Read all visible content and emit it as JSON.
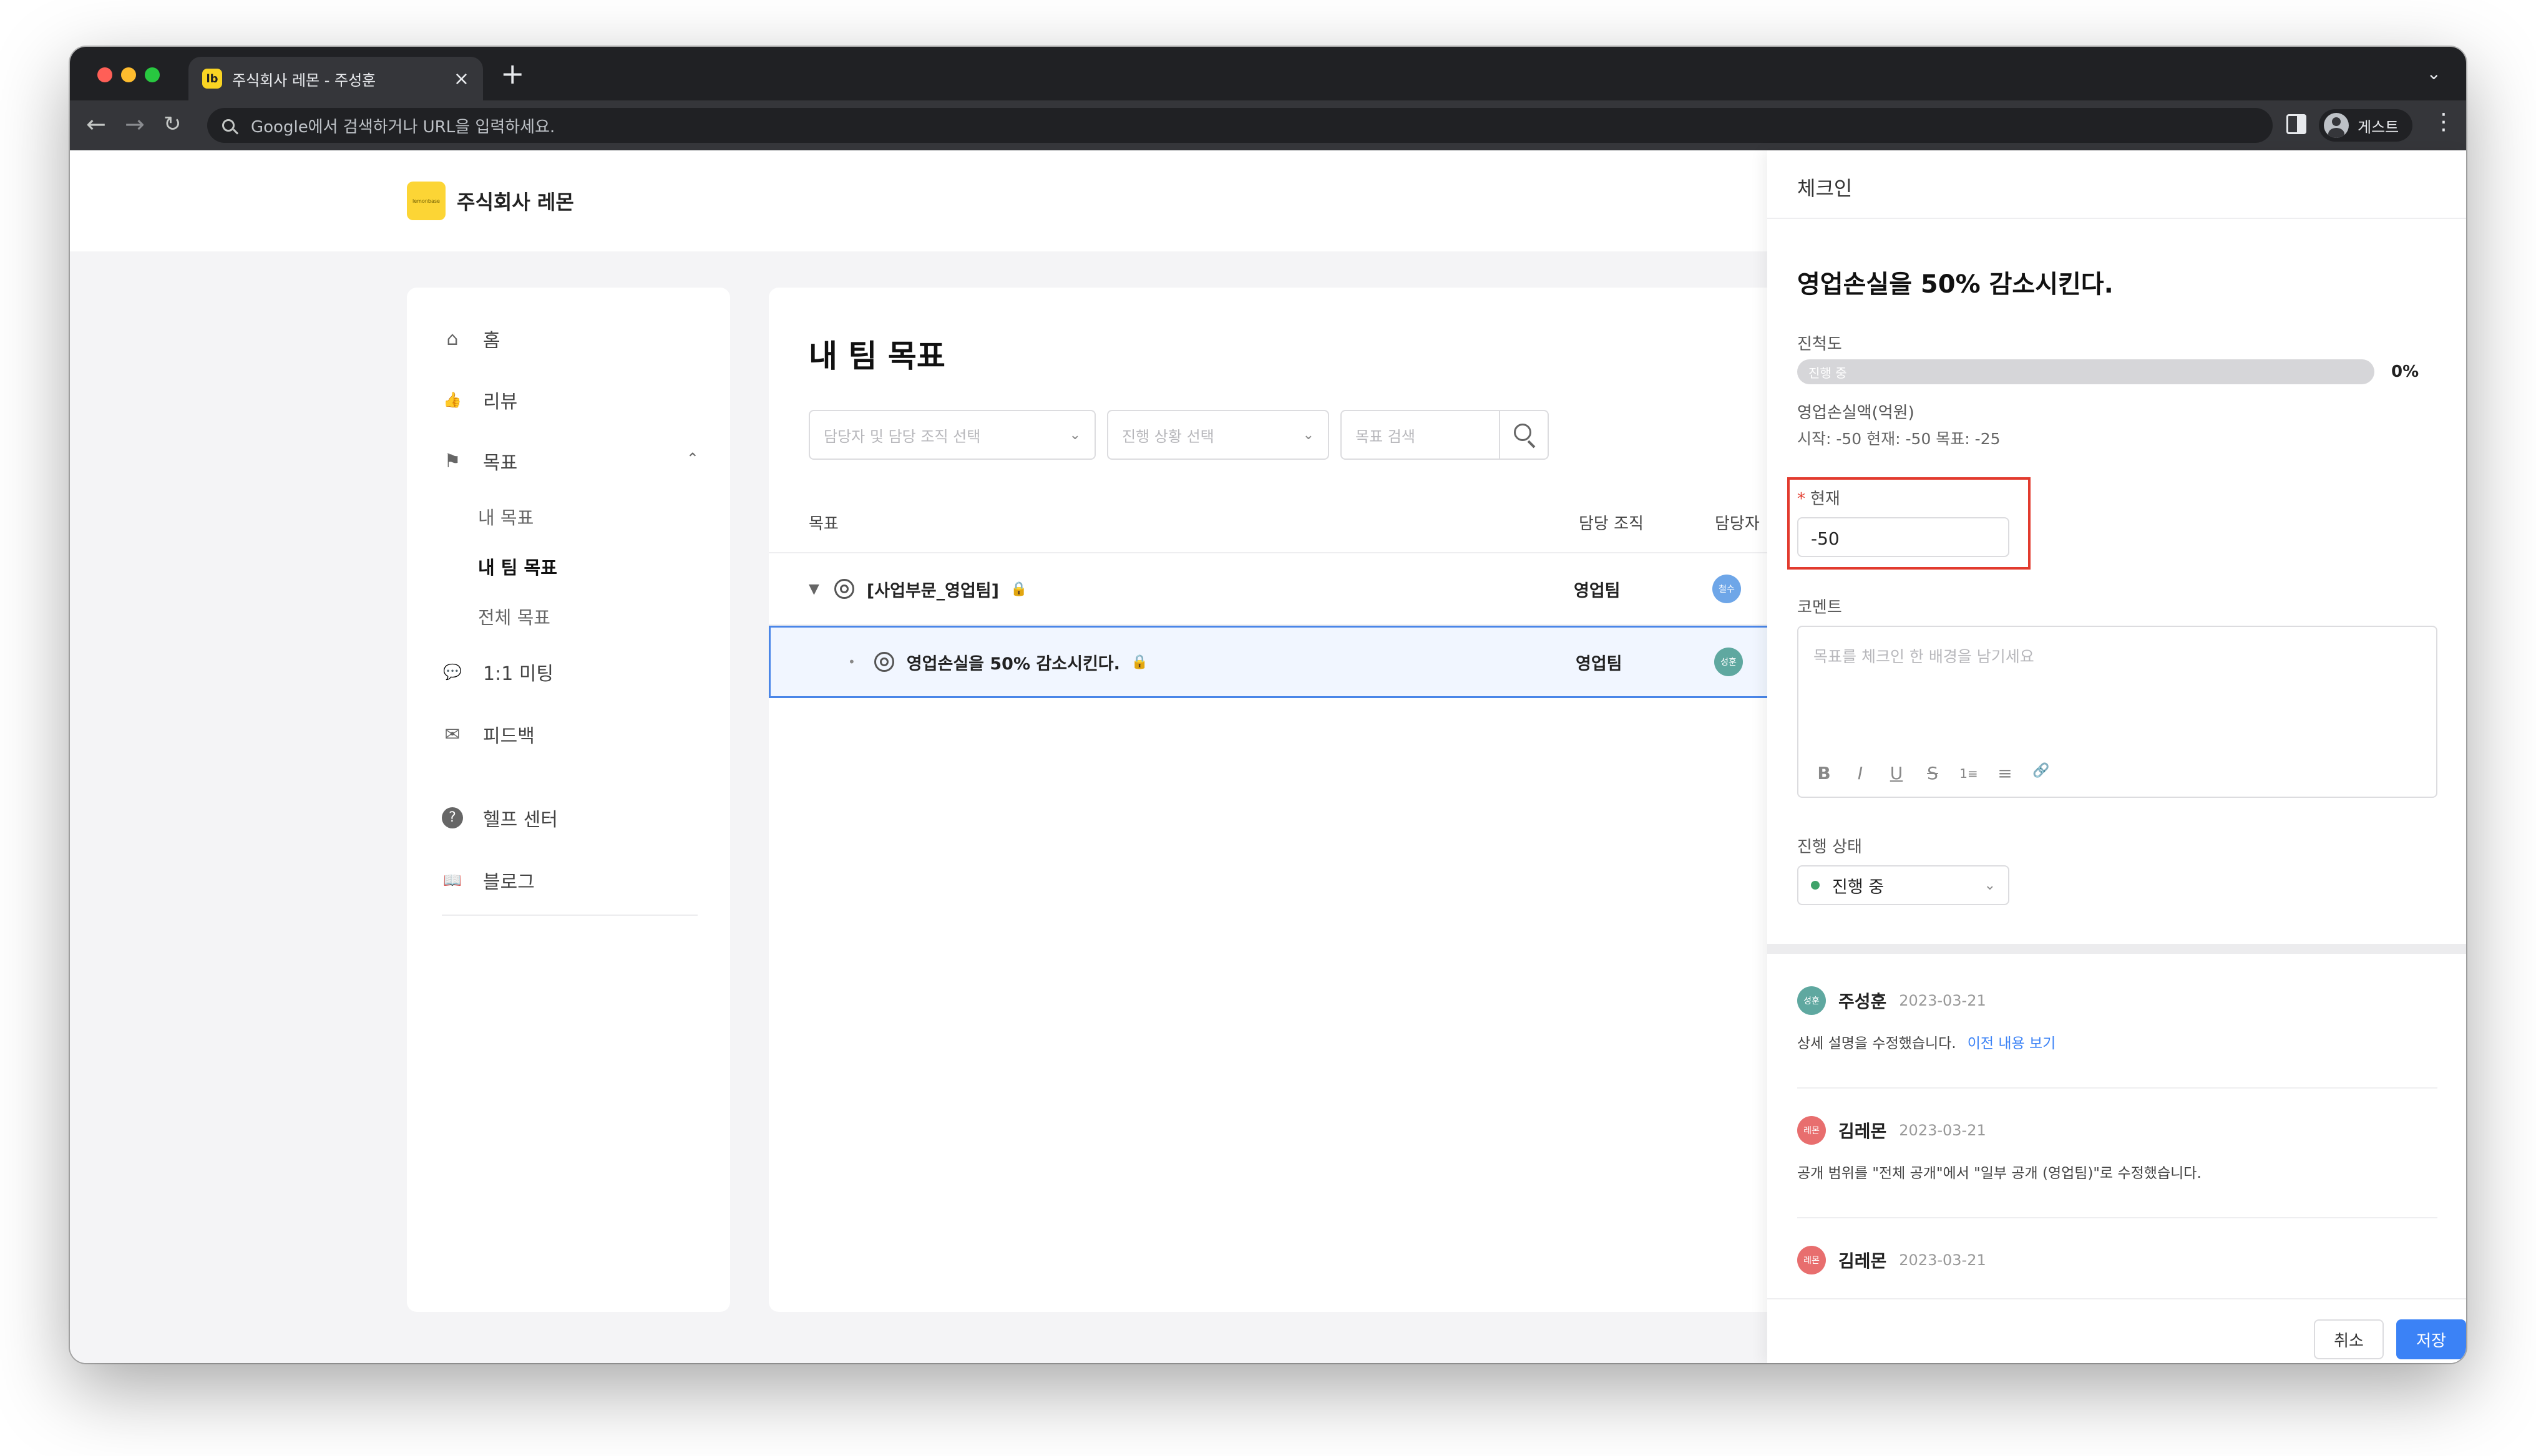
{
  "browser": {
    "tab_favicon": "lb",
    "tab_title": "주식회사 레몬 - 주성훈",
    "tab_close": "×",
    "new_tab": "+",
    "omnibox_placeholder": "Google에서 검색하거나 URL을 입력하세요.",
    "profile_label": "게스트"
  },
  "header": {
    "logo_text": "lemonbase",
    "company_name": "주식회사 레몬"
  },
  "sidebar": {
    "items": [
      {
        "label": "홈",
        "icon": "home-icon",
        "glyph": "⌂"
      },
      {
        "label": "리뷰",
        "icon": "thumbs-up-icon",
        "glyph": "👍"
      },
      {
        "label": "목표",
        "icon": "flag-icon",
        "glyph": "⚑"
      },
      {
        "label": "1:1 미팅",
        "icon": "chat-icon",
        "glyph": "💬"
      },
      {
        "label": "피드백",
        "icon": "mail-icon",
        "glyph": "✉"
      },
      {
        "label": "헬프 센터",
        "icon": "help-icon",
        "glyph": "?"
      },
      {
        "label": "블로그",
        "icon": "book-icon",
        "glyph": "📖"
      }
    ],
    "sub_items": [
      {
        "label": "내 목표",
        "active": false
      },
      {
        "label": "내 팀 목표",
        "active": true
      },
      {
        "label": "전체 목표",
        "active": false
      }
    ]
  },
  "main": {
    "title": "내 팀 목표",
    "filters": {
      "owner_placeholder": "담당자 및 담당 조직 선택",
      "status_placeholder": "진행 상황 선택",
      "search_placeholder": "목표 검색"
    },
    "table": {
      "headers": {
        "goal": "목표",
        "org": "담당 조직",
        "owner": "담당자"
      },
      "rows": [
        {
          "goal": "[사업부문_영업팀]",
          "org": "영업팀",
          "avatar": "철수",
          "avatar_color": "#6ea6e8"
        },
        {
          "goal": "영업손실을 50% 감소시킨다.",
          "org": "영업팀",
          "avatar": "성훈",
          "avatar_color": "#5fa8a0"
        }
      ]
    }
  },
  "panel": {
    "title": "체크인",
    "goal_heading": "영업손실을 50% 감소시킨다.",
    "progress_label": "진척도",
    "progress_inner_label": "진행 중",
    "progress_value": 0,
    "progress_pct_text": "0%",
    "metric_name": "영업손실액(억원)",
    "metric_stats": "시작: -50  현재: -50  목표: -25",
    "current_label": "현재",
    "required_mark": "*",
    "current_value": "-50",
    "comment_label": "코멘트",
    "comment_placeholder": "목표를 체크인 한 배경을 남기세요",
    "format_buttons": [
      "B",
      "I",
      "U",
      "S",
      "1≡",
      "≡",
      "🔗"
    ],
    "status_label": "진행 상태",
    "status_value": "진행 중",
    "status_color": "#3fa36a",
    "history": [
      {
        "name": "주성훈",
        "avatar": "성훈",
        "avatar_color": "#5fa8a0",
        "date": "2023-03-21",
        "desc": "상세 설명을 수정했습니다.",
        "link": "이전 내용 보기"
      },
      {
        "name": "김레몬",
        "avatar": "레몬",
        "avatar_color": "#e86e6e",
        "date": "2023-03-21",
        "desc": "공개 범위를 \"전체 공개\"에서 \"일부 공개 (영업팀)\"로 수정했습니다.",
        "link": ""
      },
      {
        "name": "김레몬",
        "avatar": "레몬",
        "avatar_color": "#e86e6e",
        "date": "2023-03-21",
        "desc": "",
        "link": ""
      }
    ],
    "cancel_label": "취소",
    "save_label": "저장"
  }
}
